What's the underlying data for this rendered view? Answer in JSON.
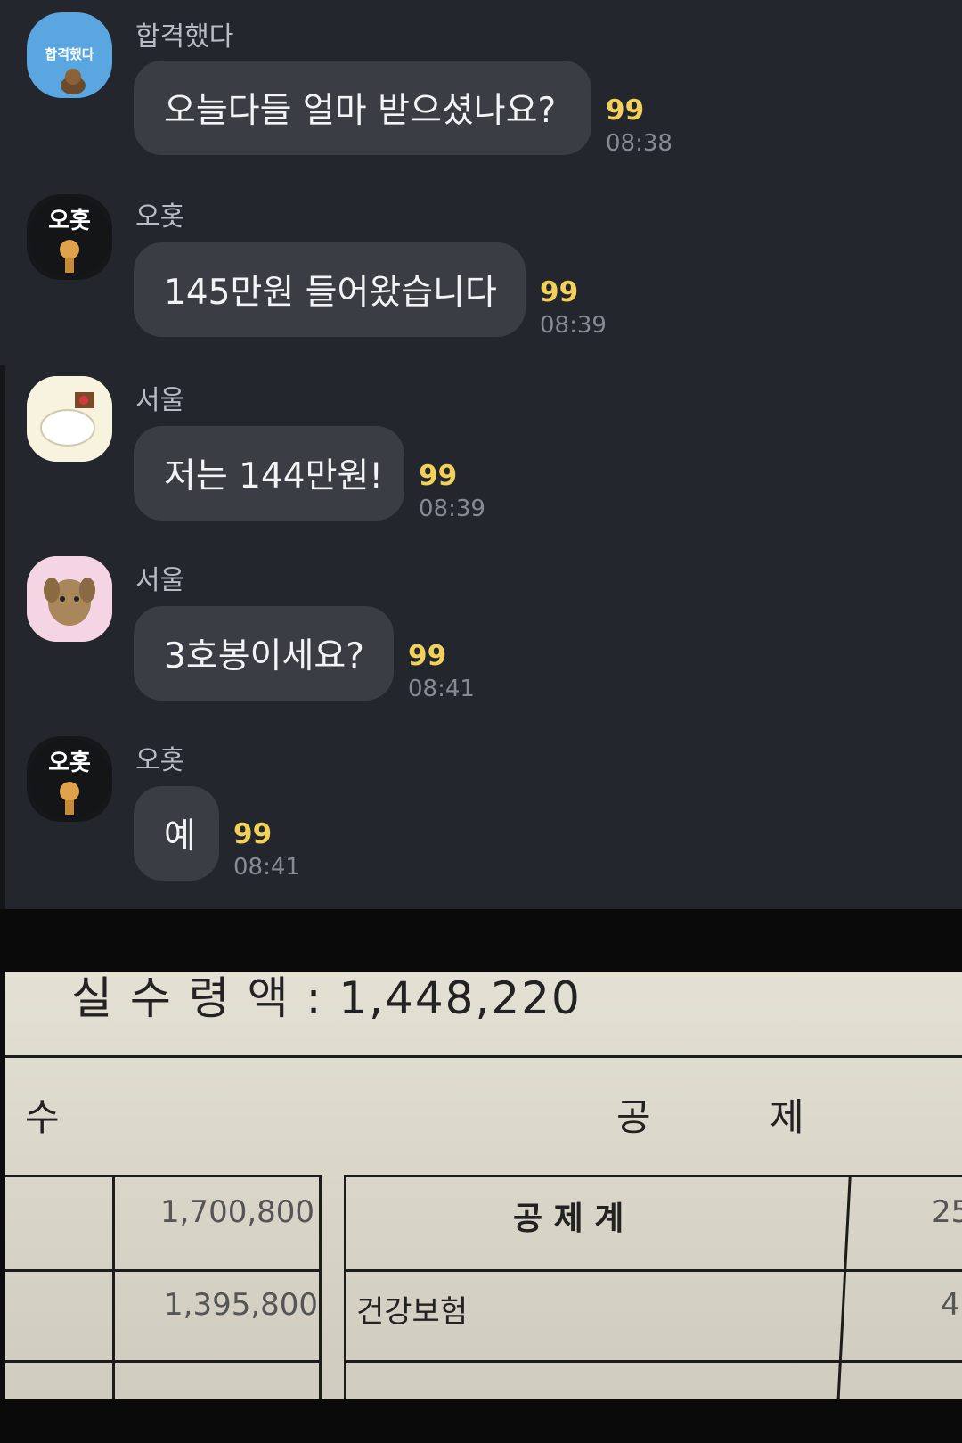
{
  "messages": [
    {
      "sender": "합격했다",
      "text": "오늘다들 얼마 받으셨나요?",
      "unread": "99",
      "time": "08:38"
    },
    {
      "sender": "오홋",
      "text": "145만원 들어왔습니다",
      "unread": "99",
      "time": "08:39"
    },
    {
      "sender": "서울",
      "text": "저는 144만원!",
      "unread": "99",
      "time": "08:39"
    },
    {
      "sender": "서울",
      "text": "3호봉이세요?",
      "unread": "99",
      "time": "08:41"
    },
    {
      "sender": "오홋",
      "text": "예",
      "unread": "99",
      "time": "08:41"
    }
  ],
  "avatars": {
    "a0_label": "합격했다",
    "a1_label": "오홋",
    "a4_label": "오홋"
  },
  "payslip": {
    "net_label": "실 수 령 액 : 1,448,220",
    "col_left": "수",
    "col_gong": "공",
    "col_je": "제",
    "row1_amount": "1,700,800",
    "row1_label": "공  제  계",
    "row1_right": "25",
    "row2_amount": "1,395,800",
    "row2_label": "건강보험",
    "row2_right": "4"
  },
  "colors": {
    "chat_bg": "#24262d",
    "bubble": "#3a3d44",
    "unread": "#f2d15b",
    "time": "#868a93"
  }
}
